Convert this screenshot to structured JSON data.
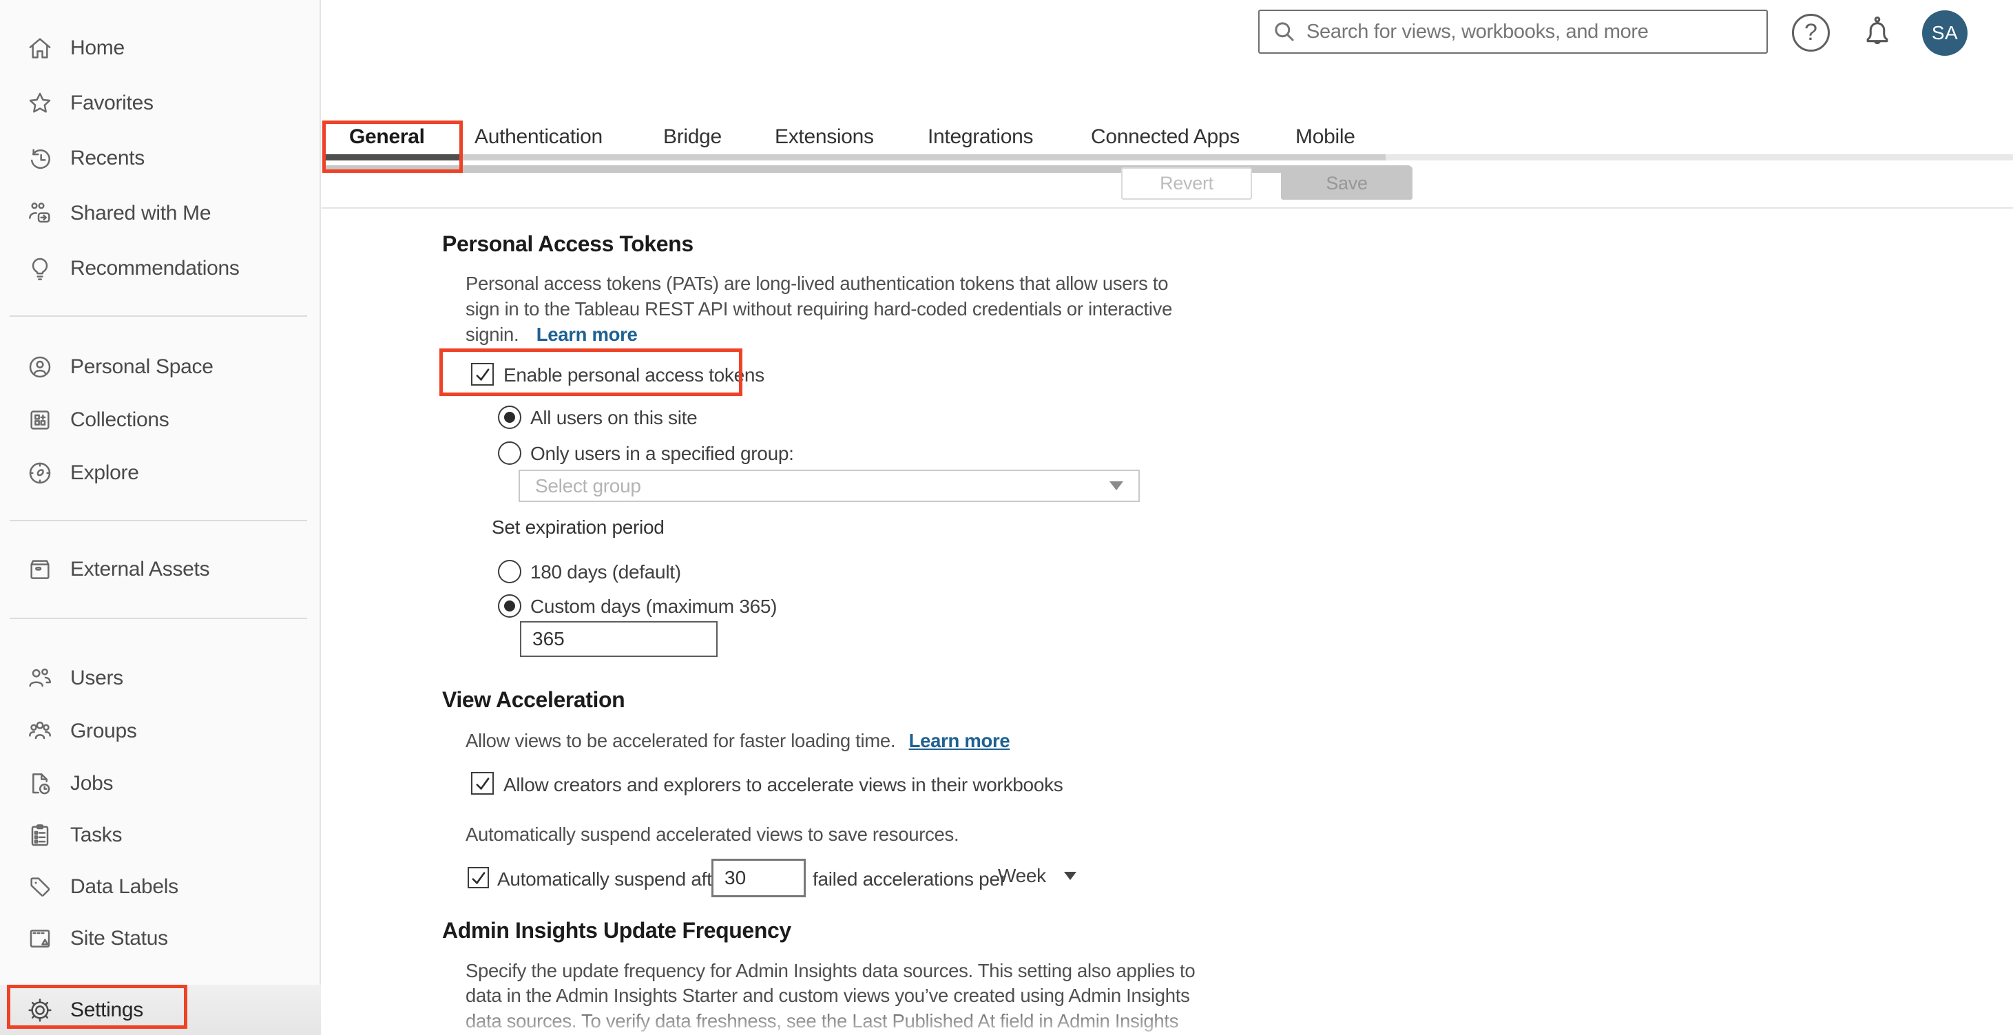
{
  "colors": {
    "annotation_red": "#ee4226",
    "link_blue": "#1e6193",
    "avatar_bg": "#2f5f7d",
    "tab_indicator": "#4f4f4f",
    "sidebar_selected_bg": "#e8e8e8"
  },
  "header": {
    "search_placeholder": "Search for views, workbooks, and more",
    "help_glyph": "?",
    "avatar_initials": "SA"
  },
  "sidebar": {
    "items": [
      {
        "label": "Home",
        "icon": "home-icon"
      },
      {
        "label": "Favorites",
        "icon": "star-icon"
      },
      {
        "label": "Recents",
        "icon": "history-clock-icon"
      },
      {
        "label": "Shared with Me",
        "icon": "shared-people-icon"
      },
      {
        "label": "Recommendations",
        "icon": "lightbulb-icon"
      },
      {
        "label": "Personal Space",
        "icon": "person-circle-icon"
      },
      {
        "label": "Collections",
        "icon": "collections-grid-icon"
      },
      {
        "label": "Explore",
        "icon": "compass-icon"
      },
      {
        "label": "External Assets",
        "icon": "archive-box-icon"
      },
      {
        "label": "Users",
        "icon": "users-icon"
      },
      {
        "label": "Groups",
        "icon": "groups-icon"
      },
      {
        "label": "Jobs",
        "icon": "document-clock-icon"
      },
      {
        "label": "Tasks",
        "icon": "clipboard-list-icon"
      },
      {
        "label": "Data Labels",
        "icon": "tag-icon"
      },
      {
        "label": "Site Status",
        "icon": "window-status-icon"
      },
      {
        "label": "Settings",
        "icon": "gear-icon",
        "selected": true
      }
    ]
  },
  "tabs": {
    "items": [
      {
        "label": "General",
        "selected": true
      },
      {
        "label": "Authentication"
      },
      {
        "label": "Bridge"
      },
      {
        "label": "Extensions"
      },
      {
        "label": "Integrations"
      },
      {
        "label": "Connected Apps"
      },
      {
        "label": "Mobile"
      }
    ]
  },
  "actions": {
    "revert_label": "Revert",
    "save_label": "Save"
  },
  "sections": {
    "pat": {
      "title": "Personal Access Tokens",
      "desc_line1": "Personal access tokens (PATs) are long-lived authentication tokens that allow users to",
      "desc_line2": "sign in to the Tableau REST API without requiring hard-coded credentials or interactive",
      "desc_line3": "signin.",
      "learn_more": "Learn more",
      "enable_checkbox_label": "Enable personal access tokens",
      "enable_checkbox_checked": true,
      "radio_all_users": "All users on this site",
      "radio_all_users_selected": true,
      "radio_specified_group": "Only users in a specified group:",
      "radio_specified_group_selected": false,
      "group_select_placeholder": "Select group",
      "expiration_label": "Set expiration period",
      "radio_180": "180 days (default)",
      "radio_180_selected": false,
      "radio_custom": "Custom days (maximum 365)",
      "radio_custom_selected": true,
      "custom_days_value": "365"
    },
    "view_acceleration": {
      "title": "View Acceleration",
      "desc": "Allow views to be accelerated for faster loading time.",
      "learn_more": "Learn more",
      "allow_checkbox_label": "Allow creators and explorers to accelerate views in their workbooks",
      "allow_checkbox_checked": true,
      "suspend_desc": "Automatically suspend accelerated views to save resources.",
      "suspend_checkbox_checked": true,
      "suspend_prefix": "Automatically suspend after",
      "suspend_value": "30",
      "suspend_suffix": "failed accelerations per",
      "period_value": "Week"
    },
    "admin_insights": {
      "title": "Admin Insights Update Frequency",
      "desc_line1": "Specify the update frequency for Admin Insights data sources. This setting also applies to",
      "desc_line2": "data in the Admin Insights Starter and custom views you’ve created using Admin Insights",
      "desc_line3": "data sources. To verify data freshness, see the Last Published At field in Admin Insights"
    }
  }
}
